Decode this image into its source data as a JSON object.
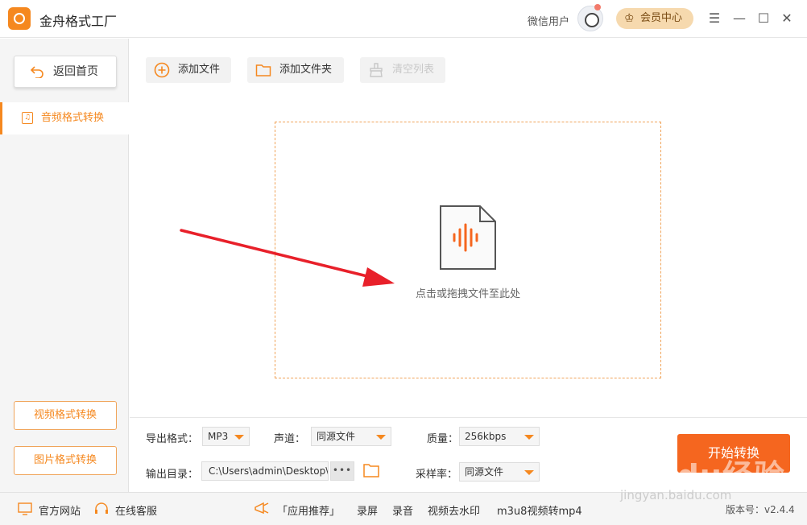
{
  "app": {
    "title": "金舟格式工厂"
  },
  "header": {
    "user_name": "微信用户",
    "vip_label": "会员中心",
    "vip_icon": "♔"
  },
  "window_controls": {
    "menu": "☰",
    "minimize": "—",
    "maximize": "☐",
    "close": "✕"
  },
  "sidebar": {
    "back_label": "返回首页",
    "active_item": "音频格式转换",
    "video_btn": "视频格式转换",
    "image_btn": "图片格式转换"
  },
  "toolbar": {
    "add_file": "添加文件",
    "add_folder": "添加文件夹",
    "clear_list": "清空列表"
  },
  "dropzone": {
    "text": "点击或拖拽文件至此处"
  },
  "settings": {
    "format_label": "导出格式：",
    "format_value": "MP3",
    "channel_label": "声道：",
    "channel_value": "同源文件",
    "quality_label": "质量：",
    "quality_value": "256kbps",
    "output_label": "输出目录：",
    "output_path": "C:\\Users\\admin\\Desktop\\",
    "more": "•••",
    "samplerate_label": "采样率：",
    "samplerate_value": "同源文件",
    "start_label": "开始转换"
  },
  "statusbar": {
    "website": "官方网站",
    "support": "在线客服",
    "recommend": "「应用推荐」",
    "record_screen": "录屏",
    "record_audio": "录音",
    "watermark_remove": "视频去水印",
    "m3u8": "m3u8视频转mp4",
    "version_label": "版本号：",
    "version_value": "v2.4.4"
  },
  "watermark": {
    "brand": "Baidu经验",
    "url": "jingyan.baidu.com"
  },
  "colors": {
    "accent": "#f5881f",
    "start": "#f5661f",
    "arrow": "#e8202a"
  }
}
